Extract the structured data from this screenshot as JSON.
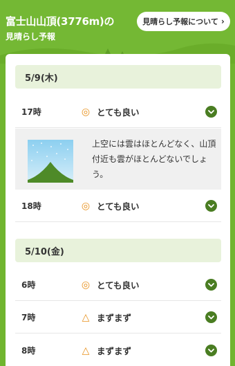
{
  "header": {
    "title_line1": "富士山山頂(3776m)の",
    "title_line2": "見晴らし予報",
    "about_button": "見晴らし予報について",
    "about_chevron": "›"
  },
  "days": [
    {
      "date": "5/9(木)",
      "slots": [
        {
          "time": "17時",
          "mark": "◎",
          "rating": "とても良い",
          "expanded": true,
          "detail": "上空には雲はほとんどなく、山頂付近も雲がほとんどないでしょう。"
        },
        {
          "time": "18時",
          "mark": "◎",
          "rating": "とても良い",
          "expanded": false
        }
      ]
    },
    {
      "date": "5/10(金)",
      "slots": [
        {
          "time": "6時",
          "mark": "◎",
          "rating": "とても良い",
          "expanded": false
        },
        {
          "time": "7時",
          "mark": "△",
          "rating": "まずまず",
          "expanded": false
        },
        {
          "time": "8時",
          "mark": "△",
          "rating": "まずまず",
          "expanded": false
        }
      ]
    }
  ],
  "colors": {
    "background": "#70b52f",
    "accent_dark": "#4a7d22",
    "mark": "#e8911c",
    "date_bar": "#e8f2db"
  }
}
